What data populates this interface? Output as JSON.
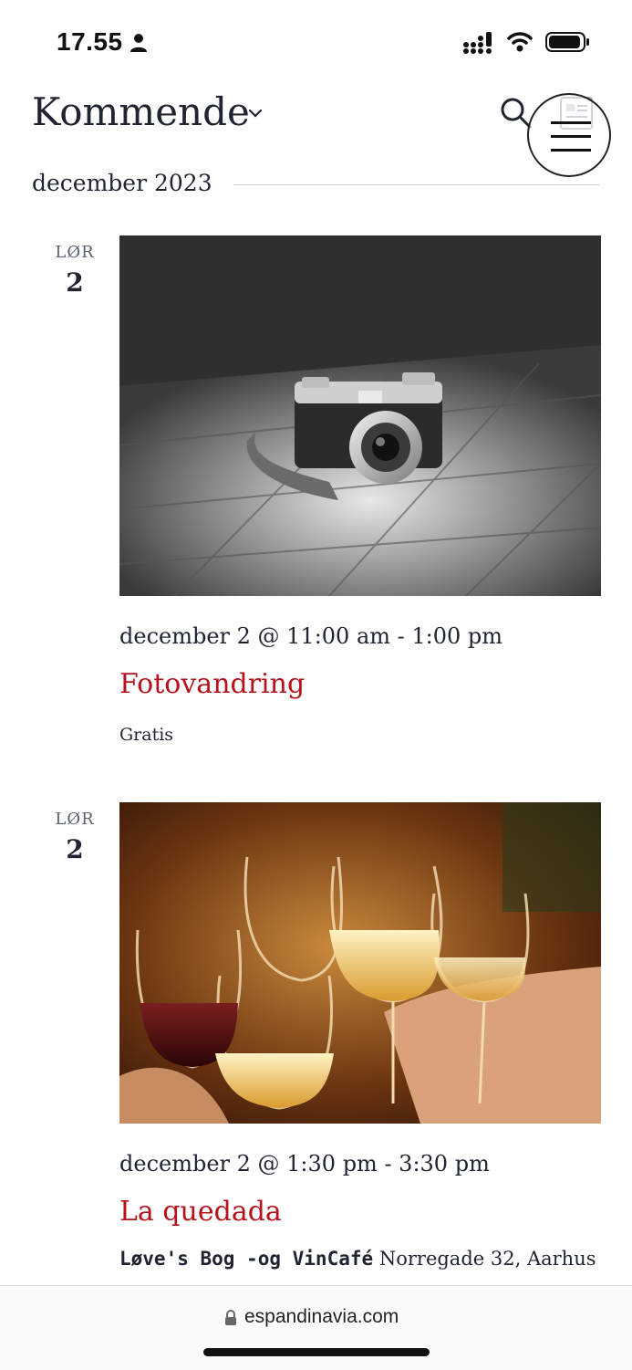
{
  "status_bar": {
    "time": "17.55"
  },
  "header": {
    "view_title": "Kommende"
  },
  "month": {
    "label": "december 2023"
  },
  "events": [
    {
      "day_of_week": "LØR",
      "day": "2",
      "datetime": "december 2 @ 11:00 am - 1:00 pm",
      "title": "Fotovandring",
      "cost": "Gratis",
      "image_subject": "black-and-white camera on wooden table"
    },
    {
      "day_of_week": "LØR",
      "day": "2",
      "datetime": "december 2 @ 1:30 pm - 3:30 pm",
      "title": "La quedada",
      "venue_name": "Løve's Bog -og VinCafé",
      "venue_address": "Norregade 32, Aarhus",
      "image_subject": "people toasting with wine glasses"
    }
  ],
  "browser": {
    "url": "espandinavia.com"
  },
  "colors": {
    "accent": "#b5121b",
    "text": "#1f2430",
    "muted": "#5b6270"
  }
}
